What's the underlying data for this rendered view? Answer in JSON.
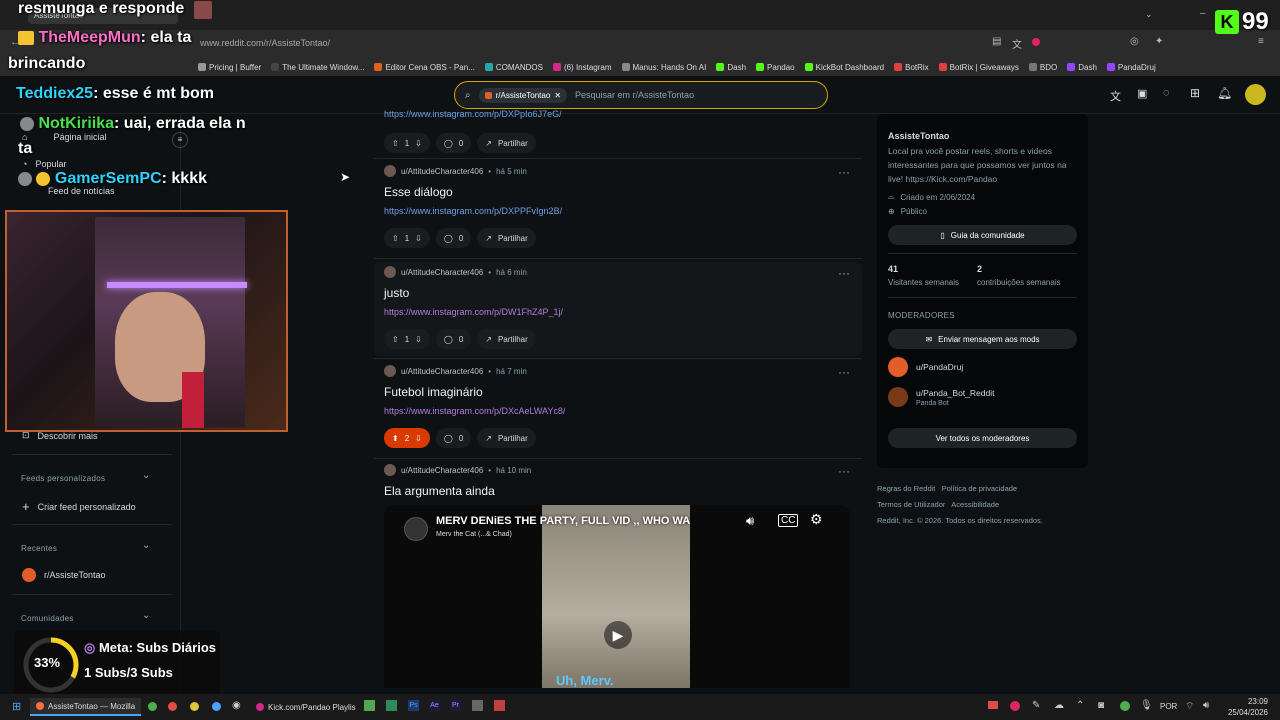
{
  "browser": {
    "tab_title": "AssisteTontao",
    "url": "www.reddit.com/r/AssisteTontao/",
    "bookmarks": [
      "Pricing | Buffer",
      "The Ultimate Window...",
      "Editor Cena OBS - Pan...",
      "COMANDOS",
      "(6) Instagram",
      "Manus: Hands On AI",
      "Dash",
      "Pandao",
      "KickBot Dashboard",
      "BotRix",
      "BotRix | Giveaways",
      "BDO",
      "Dash",
      "PandaDruj"
    ]
  },
  "search": {
    "chip": "r/AssisteTontao",
    "placeholder": "Pesquisar em r/AssisteTontao"
  },
  "sidebar": {
    "home": "Página inicial",
    "popular": "Popular",
    "news": "Feed de notícias",
    "discover": "Descobrir mais",
    "custom_feeds_header": "Feeds personalizados",
    "create_feed": "Criar feed personalizado",
    "recent_header": "Recentes",
    "recent_item": "r/AssisteTontao",
    "communities_header": "Comunidades"
  },
  "posts": [
    {
      "link": "https://www.instagram.com/p/DXPpIo6J7eG/",
      "votes": "1",
      "comments": "0",
      "share": "Partilhar"
    },
    {
      "user": "u/AttitudeCharacter406",
      "time": "há 5 min",
      "title": "Esse diálogo",
      "link": "https://www.instagram.com/p/DXPPFvIgn2B/",
      "votes": "1",
      "comments": "0",
      "share": "Partilhar"
    },
    {
      "user": "u/AttitudeCharacter406",
      "time": "há 6 min",
      "title": "justo",
      "link": "https://www.instagram.com/p/DW1FhZ4P_1j/",
      "votes": "1",
      "comments": "0",
      "share": "Partilhar"
    },
    {
      "user": "u/AttitudeCharacter406",
      "time": "há 7 min",
      "title": "Futebol imaginário",
      "link": "https://www.instagram.com/p/DXcAeLWAYc8/",
      "votes": "2",
      "comments": "0",
      "share": "Partilhar"
    },
    {
      "user": "u/AttitudeCharacter406",
      "time": "há 10 min",
      "title": "Ela argumenta ainda"
    }
  ],
  "video": {
    "title": "MERV DENiES THE PARTY, FULL VID ,, WHO WA",
    "channel": "Merv the Cat (...& Chad)",
    "caption": "Uh, Merv."
  },
  "community": {
    "name": "AssisteTontao",
    "description": "Local pra você postar reels, shorts e videos interessantes para que possamos ver juntos na live! https://Kick.com/Pandao",
    "created": "Criado em 2/06/2024",
    "visibility": "Público",
    "guide_button": "Guia da comunidade",
    "weekly_visitors": "41",
    "weekly_visitors_label": "Visitantes semanais",
    "weekly_contrib": "2",
    "weekly_contrib_label": "contribuições semanais",
    "mods_header": "MODERADORES",
    "message_mods": "Enviar mensagem aos mods",
    "mods": [
      {
        "name": "u/PandaDruj",
        "flair": ""
      },
      {
        "name": "u/Panda_Bot_Reddit",
        "flair": "Panda Bot"
      }
    ],
    "all_mods": "Ver todos os moderadores"
  },
  "footer": {
    "rules": "Regras do Reddit",
    "privacy": "Política de privacidade",
    "terms": "Termos de Utilizador",
    "accessibility": "Acessibilidade",
    "copyright": "Reddit, Inc. © 2026. Todos os direitos reservados."
  },
  "stream_overlay": {
    "top_message": "resmunga e responde",
    "chat": [
      {
        "user": "TheMeepMun",
        "text": ": ela ta"
      },
      {
        "user": "",
        "text": "brincando"
      },
      {
        "user": "Teddiex25",
        "text": ": esse é mt bom"
      },
      {
        "user": "NotKiriika",
        "text": ": uai, errada ela n"
      },
      {
        "user": "",
        "text": "ta"
      },
      {
        "user": "GamerSemPC",
        "text": ": kkkk"
      }
    ],
    "goal_percent": "33%",
    "goal_label": "Meta: Subs Diários",
    "goal_value": "1 Subs/3 Subs",
    "badge_number": "99"
  },
  "taskbar": {
    "window1": "AssisteTontao — Mozilla",
    "window2": "Kick.com/Pandao Playlis",
    "lang": "POR",
    "time": "23:09",
    "date": "25/04/2026"
  }
}
